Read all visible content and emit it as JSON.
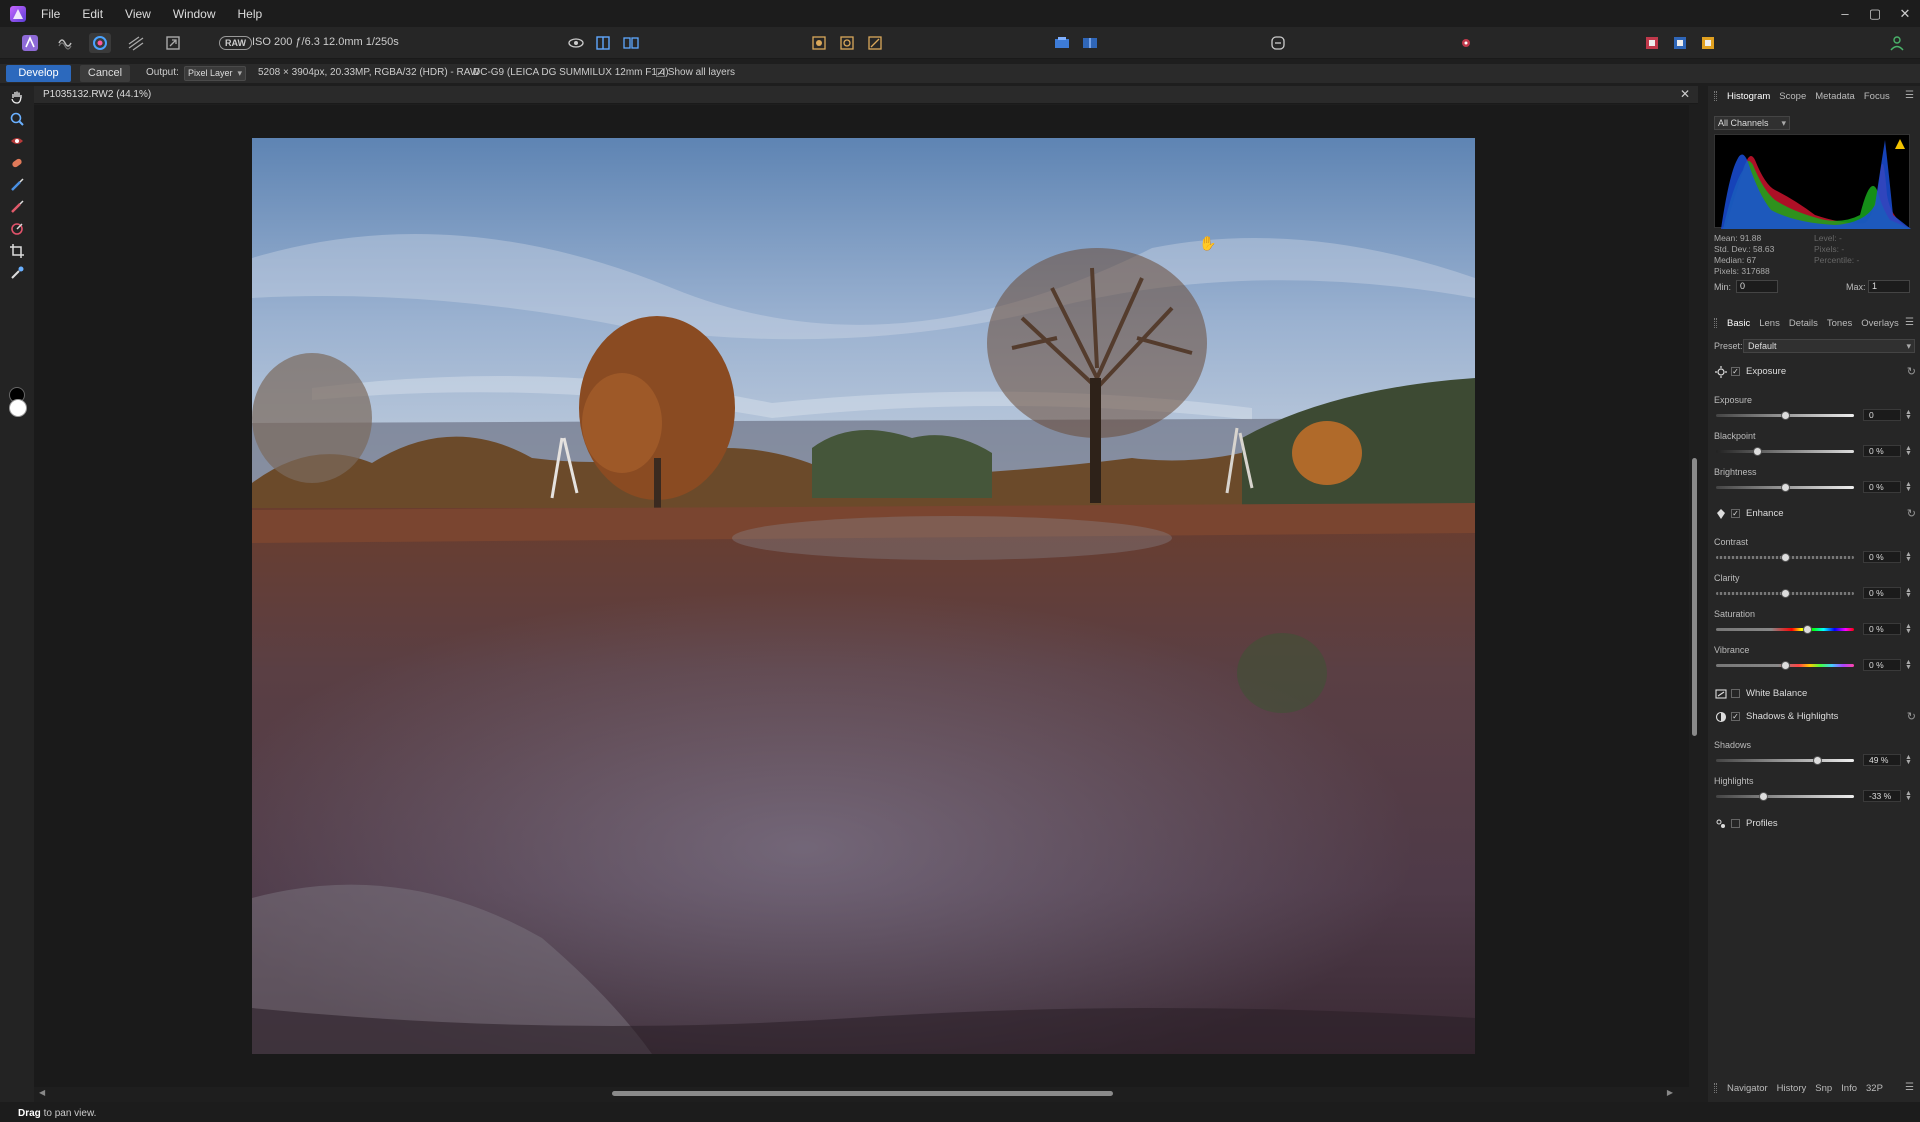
{
  "menubar": {
    "items": [
      "File",
      "Edit",
      "View",
      "Window",
      "Help"
    ]
  },
  "toolbar": {
    "raw_badge": "RAW",
    "exif": "ISO 200 ƒ/6.3 12.0mm 1/250s"
  },
  "context": {
    "develop_label": "Develop",
    "cancel_label": "Cancel",
    "output_label": "Output:",
    "output_value": "Pixel Layer",
    "image_info": "5208 × 3904px, 20.33MP, RGBA/32 (HDR) - RAW",
    "lens_info": "DC-G9 (LEICA DG SUMMILUX 12mm F1.4)",
    "show_all_layers": "Show all layers"
  },
  "document": {
    "title": "P1035132.RW2 (44.1%)"
  },
  "status": {
    "bold": "Drag",
    "rest": " to pan view."
  },
  "histogram_panel": {
    "tabs": [
      "Histogram",
      "Scope",
      "Metadata",
      "Focus"
    ],
    "channel": "All Channels",
    "stats_left": [
      "Mean: 91.88",
      "Std. Dev.: 58.63",
      "Median: 67",
      "Pixels: 317688"
    ],
    "stats_right": [
      "Level: -",
      "Pixels: -",
      "Percentile: -"
    ],
    "min_label": "Min:",
    "min_value": "0",
    "max_label": "Max:",
    "max_value": "1"
  },
  "develop_panel": {
    "tabs": [
      "Basic",
      "Lens",
      "Details",
      "Tones",
      "Overlays"
    ],
    "preset_label": "Preset:",
    "preset_value": "Default",
    "sections": {
      "exposure": "Exposure",
      "enhance": "Enhance",
      "white_balance": "White Balance",
      "shadows_highlights": "Shadows & Highlights",
      "profiles": "Profiles"
    },
    "sliders": {
      "exposure": {
        "label": "Exposure",
        "value": "0",
        "level": 0.5
      },
      "blackpoint": {
        "label": "Blackpoint",
        "value": "0 %",
        "level": 0.3
      },
      "brightness": {
        "label": "Brightness",
        "value": "0 %",
        "level": 0.5
      },
      "contrast": {
        "label": "Contrast",
        "value": "0 %",
        "level": 0.5
      },
      "clarity": {
        "label": "Clarity",
        "value": "0 %",
        "level": 0.5
      },
      "saturation": {
        "label": "Saturation",
        "value": "0 %",
        "level": 0.66
      },
      "vibrance": {
        "label": "Vibrance",
        "value": "0 %",
        "level": 0.5
      },
      "shadows": {
        "label": "Shadows",
        "value": "49 %",
        "level": 0.73
      },
      "highlights": {
        "label": "Highlights",
        "value": "-33 %",
        "level": 0.34
      }
    }
  },
  "bottom_panel": {
    "tabs": [
      "Navigator",
      "History",
      "Snp",
      "Info",
      "32P"
    ]
  },
  "colors": {
    "accent": "#2c69bd",
    "panel": "#262626",
    "canvas": "#1a1a1a"
  }
}
